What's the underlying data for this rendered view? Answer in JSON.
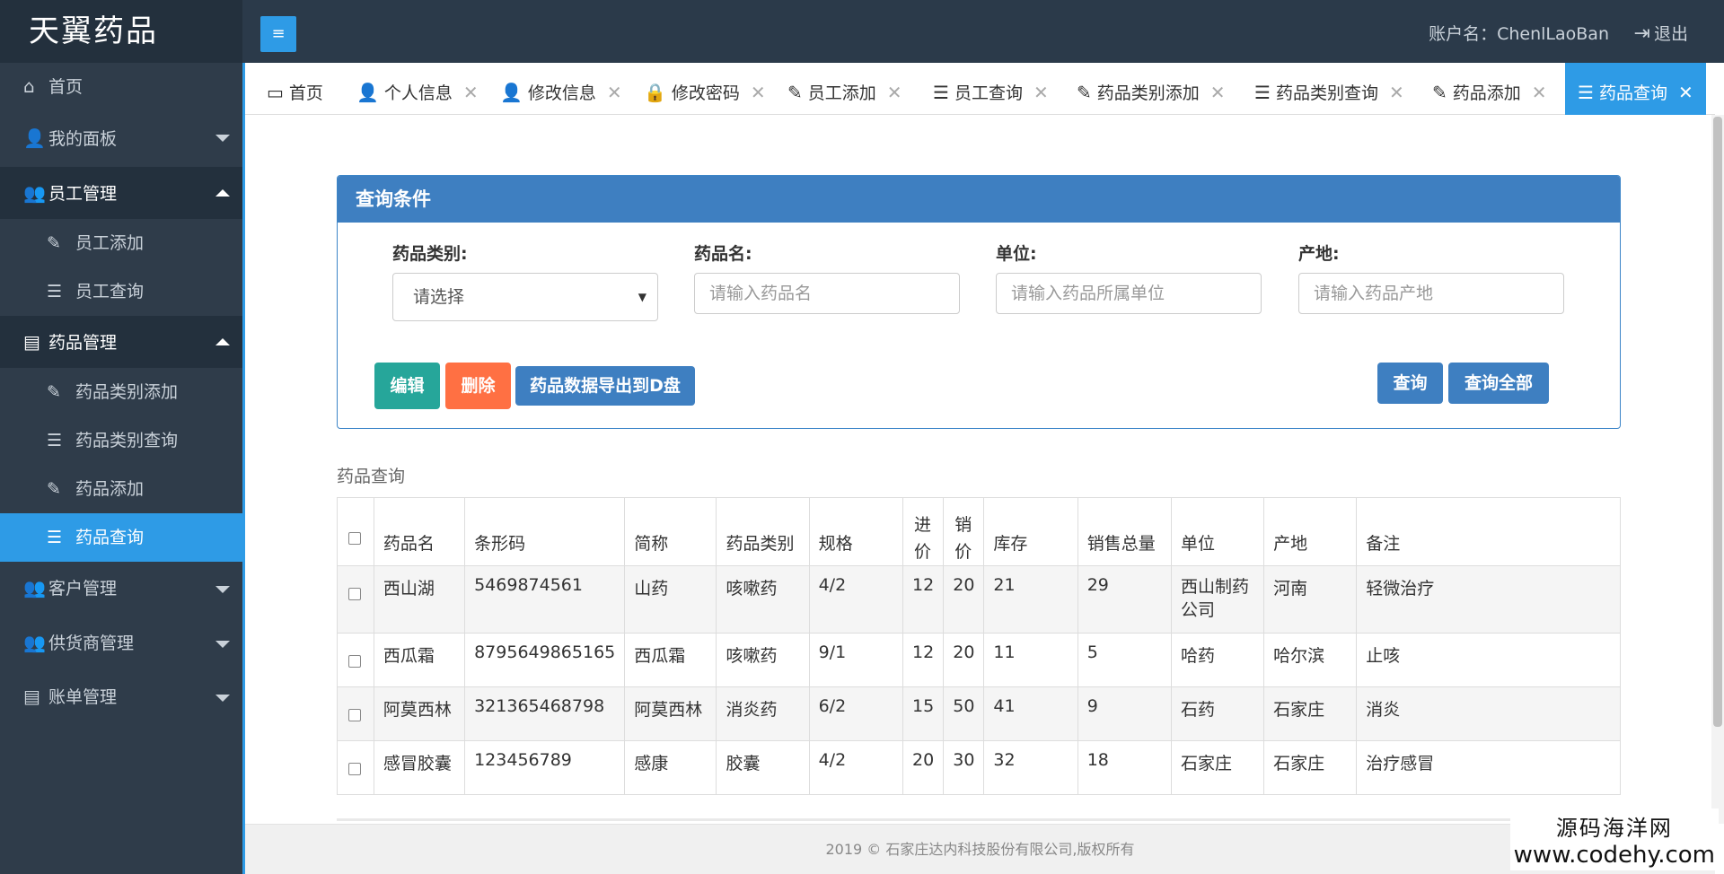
{
  "app": {
    "brand": "天翼药品",
    "menu_icon": "≡"
  },
  "header": {
    "account": "账户名：ChenlLaoBan",
    "logout": "退出",
    "logout_icon": "⇥"
  },
  "sidebar": {
    "home": {
      "label": "首页",
      "icon": "⌂"
    },
    "my_panel": {
      "label": "我的面板",
      "icon": "👤"
    },
    "staff": {
      "label": "员工管理",
      "icon": "👥"
    },
    "staff_add": {
      "label": "员工添加",
      "icon": "✎"
    },
    "staff_query": {
      "label": "员工查询",
      "icon": "☰"
    },
    "drug": {
      "label": "药品管理",
      "icon": "▤"
    },
    "drug_cat_add": {
      "label": "药品类别添加",
      "icon": "✎"
    },
    "drug_cat_query": {
      "label": "药品类别查询",
      "icon": "☰"
    },
    "drug_add": {
      "label": "药品添加",
      "icon": "✎"
    },
    "drug_query": {
      "label": "药品查询",
      "icon": "☰"
    },
    "customer": {
      "label": "客户管理",
      "icon": "👥"
    },
    "supplier": {
      "label": "供货商管理",
      "icon": "👥"
    },
    "bill": {
      "label": "账单管理",
      "icon": "▤"
    }
  },
  "tabs": [
    {
      "label": "首页",
      "icon": "▭"
    },
    {
      "label": "个人信息",
      "icon": "👤"
    },
    {
      "label": "修改信息",
      "icon": "👤"
    },
    {
      "label": "修改密码",
      "icon": "🔒"
    },
    {
      "label": "员工添加",
      "icon": "✎"
    },
    {
      "label": "员工查询",
      "icon": "☰"
    },
    {
      "label": "药品类别添加",
      "icon": "✎"
    },
    {
      "label": "药品类别查询",
      "icon": "☰"
    },
    {
      "label": "药品添加",
      "icon": "✎"
    },
    {
      "label": "药品查询",
      "icon": "☰"
    }
  ],
  "tab_close": "✕",
  "query": {
    "title": "查询条件",
    "category_label": "药品类别:",
    "category_value": "请选择",
    "name_label": "药品名:",
    "name_placeholder": "请输入药品名",
    "unit_label": "单位:",
    "unit_placeholder": "请输入药品所属单位",
    "origin_label": "产地:",
    "origin_placeholder": "请输入药品产地",
    "edit": "编辑",
    "delete": "删除",
    "export": "药品数据导出到D盘",
    "search": "查询",
    "search_all": "查询全部"
  },
  "list": {
    "title": "药品查询",
    "headers": [
      "药品名",
      "条形码",
      "简称",
      "药品类别",
      "规格",
      "进价",
      "销价",
      "库存",
      "销售总量",
      "单位",
      "产地",
      "备注"
    ],
    "rows": [
      [
        "西山湖",
        "5469874561",
        "山药",
        "咳嗽药",
        "4/2",
        "12",
        "20",
        "21",
        "29",
        "西山制药公司",
        "河南",
        "轻微治疗"
      ],
      [
        "西瓜霜",
        "8795649865165",
        "西瓜霜",
        "咳嗽药",
        "9/1",
        "12",
        "20",
        "11",
        "5",
        "哈药",
        "哈尔滨",
        "止咳"
      ],
      [
        "阿莫西林",
        "321365468798",
        "阿莫西林",
        "消炎药",
        "6/2",
        "15",
        "50",
        "41",
        "9",
        "石药",
        "石家庄",
        "消炎"
      ],
      [
        "感冒胶囊",
        "123456789",
        "感康",
        "胶囊",
        "4/2",
        "20",
        "30",
        "32",
        "18",
        "石家庄",
        "石家庄",
        "治疗感冒"
      ]
    ]
  },
  "footer": "2019 © 石家庄达内科技股份有限公司,版权所有",
  "watermark": {
    "line1": "源码海洋网",
    "line2": "www.codehy.com"
  }
}
